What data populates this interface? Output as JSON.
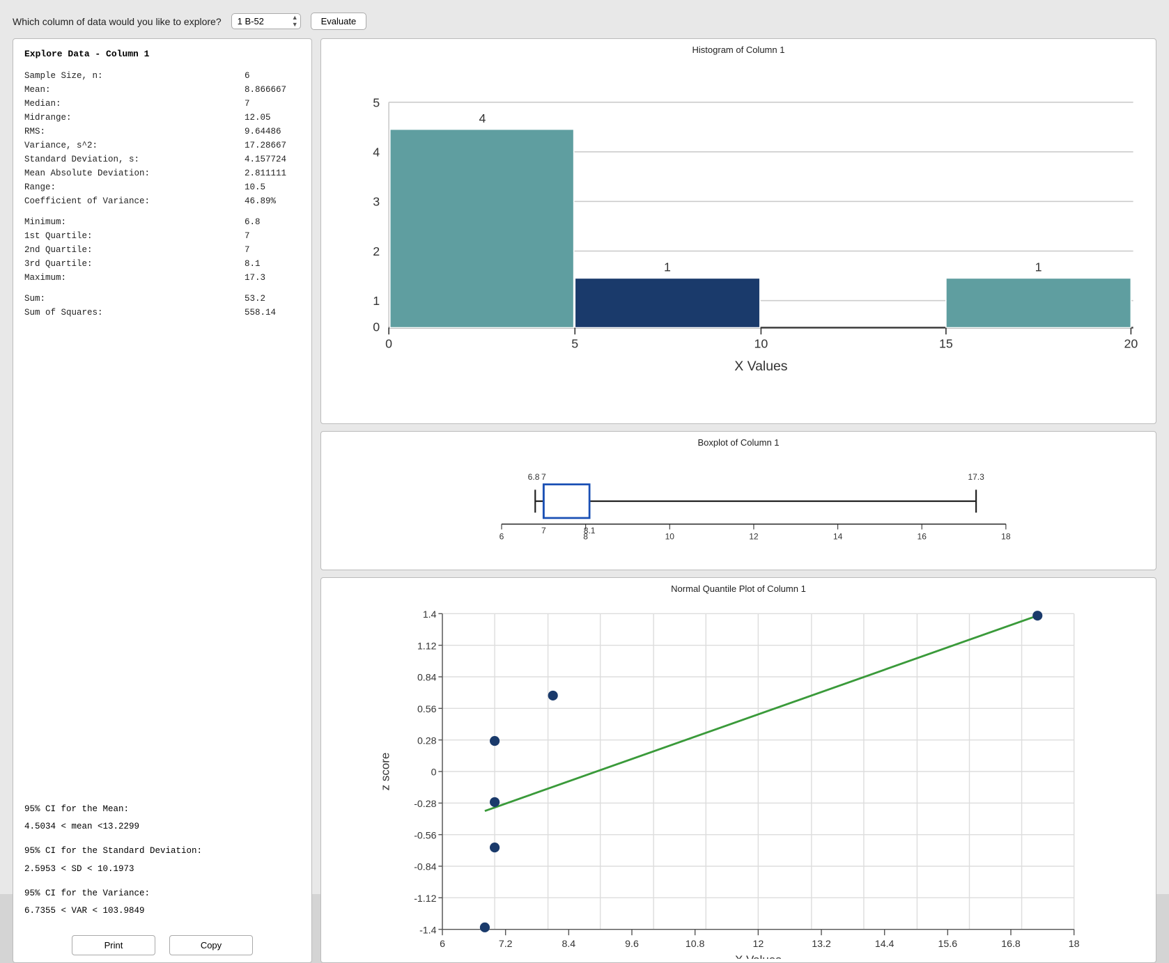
{
  "topbar": {
    "label": "Which column of data would you like to explore?",
    "dropdown_value": "1 B-52",
    "evaluate_label": "Evaluate"
  },
  "left_panel": {
    "title": "Explore Data -  Column 1",
    "stats": [
      {
        "label": "Sample Size, n:",
        "value": "6"
      },
      {
        "label": "Mean:",
        "value": "8.866667"
      },
      {
        "label": "Median:",
        "value": "7"
      },
      {
        "label": "Midrange:",
        "value": "12.05"
      },
      {
        "label": "RMS:",
        "value": "9.64486"
      },
      {
        "label": "Variance, s^2:",
        "value": "17.28667"
      },
      {
        "label": "Standard Deviation, s:",
        "value": "4.157724"
      },
      {
        "label": "Mean Absolute Deviation:",
        "value": "2.811111"
      },
      {
        "label": "Range:",
        "value": "10.5"
      },
      {
        "label": "Coefficient of Variance:",
        "value": "46.89%"
      }
    ],
    "quartiles": [
      {
        "label": "Minimum:",
        "value": "6.8"
      },
      {
        "label": "1st Quartile:",
        "value": "7"
      },
      {
        "label": "2nd Quartile:",
        "value": "7"
      },
      {
        "label": "3rd Quartile:",
        "value": "8.1"
      },
      {
        "label": "Maximum:",
        "value": "17.3"
      }
    ],
    "sums": [
      {
        "label": "Sum:",
        "value": "53.2"
      },
      {
        "label": "Sum of Squares:",
        "value": "558.14"
      }
    ],
    "ci_mean_label": "95% CI for the Mean:",
    "ci_mean_value": "4.5034 < mean <13.2299",
    "ci_sd_label": "95% CI for the Standard Deviation:",
    "ci_sd_value": "2.5953 < SD < 10.1973",
    "ci_var_label": "95% CI for the Variance:",
    "ci_var_value": "6.7355 < VAR < 103.9849",
    "print_label": "Print",
    "copy_label": "Copy"
  },
  "histogram": {
    "title": "Histogram of Column 1",
    "x_label": "X Values",
    "bars": [
      {
        "x_start": 0,
        "x_end": 5,
        "count": 4,
        "color": "#5f9ea0"
      },
      {
        "x_start": 5,
        "x_end": 10,
        "count": 1,
        "color": "#1a3a6b"
      },
      {
        "x_start": 10,
        "x_end": 15,
        "count": 0,
        "color": "#5f9ea0"
      },
      {
        "x_start": 15,
        "x_end": 20,
        "count": 1,
        "color": "#5f9ea0"
      }
    ],
    "x_ticks": [
      "0",
      "5",
      "10",
      "15",
      "20"
    ],
    "y_ticks": [
      "0",
      "1",
      "2",
      "3",
      "4",
      "5"
    ],
    "bar_labels": [
      "4",
      "",
      "1",
      "1"
    ]
  },
  "boxplot": {
    "title": "Boxplot of Column 1",
    "x_label": "",
    "min": 6.8,
    "q1": 7,
    "median": 7,
    "q3": 8.1,
    "max": 17.3,
    "x_ticks": [
      "6",
      "8",
      "10",
      "12",
      "14",
      "16",
      "18"
    ],
    "labels": {
      "min": "6.8",
      "q1": "7",
      "q3": "8.1",
      "max": "17.3",
      "median_label": "7"
    }
  },
  "qqplot": {
    "title": "Normal Quantile Plot of Column 1",
    "x_label": "X Values",
    "y_label": "z score",
    "x_ticks": [
      "6",
      "7.2",
      "8.4",
      "9.6",
      "10.8",
      "12",
      "13.2",
      "14.4",
      "15.6",
      "16.8",
      "18"
    ],
    "y_ticks": [
      "-1.4",
      "-1.12",
      "-0.84",
      "-0.56",
      "-0.28",
      "0",
      "0.28",
      "0.56",
      "0.84",
      "1.12",
      "1.4"
    ],
    "points": [
      {
        "x": 6.8,
        "z": -1.38
      },
      {
        "x": 7.0,
        "z": -0.67
      },
      {
        "x": 7.0,
        "z": -0.27
      },
      {
        "x": 7.0,
        "z": 0.27
      },
      {
        "x": 8.1,
        "z": 0.67
      },
      {
        "x": 17.3,
        "z": 1.38
      }
    ],
    "line_start": {
      "x": 6.8,
      "z": -0.35
    },
    "line_end": {
      "x": 17.3,
      "z": 1.38
    }
  }
}
